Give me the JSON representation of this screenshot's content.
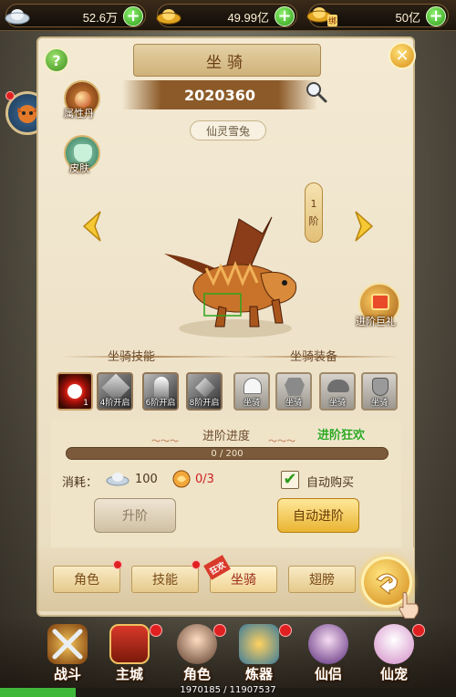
{
  "currency": [
    {
      "icon": "silver-ingot-icon",
      "value": "52.6万"
    },
    {
      "icon": "gold-ingot-icon",
      "value": "49.99亿"
    },
    {
      "icon": "bound-gold-icon",
      "tag": "绑",
      "value": "50亿"
    }
  ],
  "panel": {
    "title": "坐骑",
    "power": "2020360",
    "mount_name": "仙灵雪兔",
    "left_icons": [
      {
        "label": "属性丹",
        "icon": "attribute-pill-icon"
      },
      {
        "label": "皮肤",
        "icon": "skin-icon"
      }
    ],
    "stage": {
      "number": "1",
      "unit": "阶"
    },
    "stage_gift": "进阶巨礼",
    "sections": {
      "skills": "坐骑技能",
      "equipment": "坐骑装备"
    },
    "skills": [
      {
        "label": "",
        "num": "1",
        "icon": "fire-orb-skill-icon"
      },
      {
        "label": "4阶开启",
        "num": "",
        "icon": "locked-skill-icon"
      },
      {
        "label": "6阶开启",
        "num": "",
        "icon": "locked-skill-icon"
      },
      {
        "label": "8阶开启",
        "num": "",
        "icon": "locked-skill-icon"
      }
    ],
    "equipment": [
      {
        "label": "坐骑",
        "icon": "helmet-equip-icon"
      },
      {
        "label": "坐骑",
        "icon": "armor-equip-icon"
      },
      {
        "label": "坐骑",
        "icon": "saddle-equip-icon"
      },
      {
        "label": "坐骑",
        "icon": "hoof-equip-icon"
      }
    ],
    "progress": {
      "title": "进阶进度",
      "bonus": "进阶狂欢",
      "text": "0 / 200",
      "fraction": 0
    },
    "cost": {
      "label": "消耗：",
      "silver": "100",
      "item": "0/3"
    },
    "auto_buy": {
      "label": "自动购买",
      "checked": "✔"
    },
    "buttons": {
      "upgrade": "升阶",
      "auto_advance": "自动进阶"
    },
    "tabs": [
      "角色",
      "技能",
      "坐骑",
      "翅膀"
    ],
    "tab_corner": "狂欢"
  },
  "nav": [
    {
      "label": "战斗",
      "icon": "crossed-swords-icon"
    },
    {
      "label": "主城",
      "icon": "city-gate-icon"
    },
    {
      "label": "角色",
      "icon": "character-portrait-icon"
    },
    {
      "label": "炼器",
      "icon": "forge-icon"
    },
    {
      "label": "仙侣",
      "icon": "partner-portrait-icon"
    },
    {
      "label": "仙宠",
      "icon": "pet-icon"
    }
  ],
  "exp": {
    "text": "1970185 / 11907537",
    "fraction": 0.165
  },
  "colors": {
    "accent": "#c9b58a",
    "positive": "#2fa51d",
    "warning": "#d02020"
  }
}
